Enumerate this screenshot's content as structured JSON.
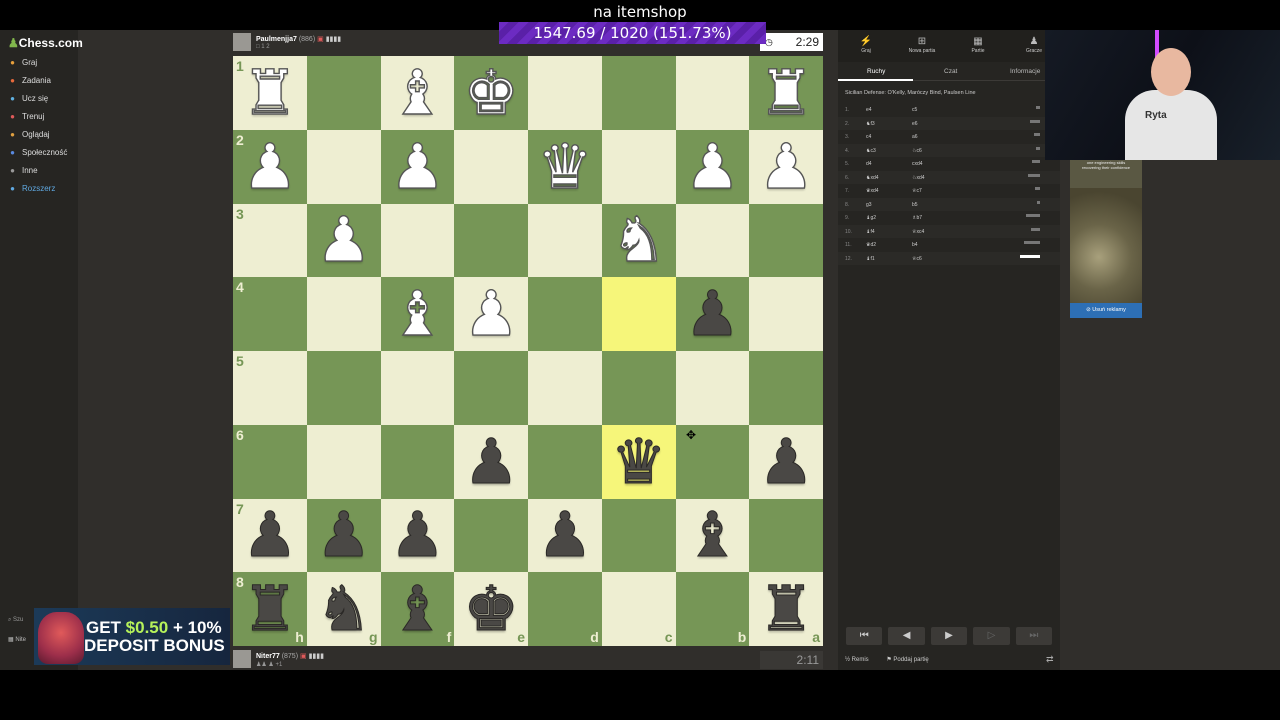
{
  "overlay": {
    "title": "na itemshop",
    "progress_text": "1547.69 / 1020 (151.73%)",
    "progress_fraction": 1.5173
  },
  "sidebar": {
    "logo": "Chess.com",
    "items": [
      {
        "label": "Graj",
        "icon": "play-icon",
        "color": "#e8a03c"
      },
      {
        "label": "Zadania",
        "icon": "puzzle-icon",
        "color": "#e86a3c"
      },
      {
        "label": "Ucz się",
        "icon": "learn-icon",
        "color": "#5fb0e0"
      },
      {
        "label": "Trenuj",
        "icon": "train-icon",
        "color": "#e05a5a"
      },
      {
        "label": "Oglądaj",
        "icon": "watch-icon",
        "color": "#e0a040"
      },
      {
        "label": "Społeczność",
        "icon": "community-icon",
        "color": "#5a8ae0"
      },
      {
        "label": "Inne",
        "icon": "more-icon",
        "color": "#999999"
      },
      {
        "label": "Rozszerz",
        "icon": "diamond-icon",
        "color": "#5fa8e0"
      }
    ],
    "search_label": "Szu",
    "user_label": "Nite"
  },
  "players": {
    "top": {
      "name": "Paulmenjja7",
      "rating": "(886)",
      "meta": "□ 1 2",
      "clock": "2:29"
    },
    "bottom": {
      "name": "Niter77",
      "rating": "(875)",
      "meta": "♟♟ ♟ +1",
      "clock": "2:11"
    }
  },
  "board": {
    "ranks": [
      "1",
      "2",
      "3",
      "4",
      "5",
      "6",
      "7",
      "8"
    ],
    "files": [
      "h",
      "g",
      "f",
      "e",
      "d",
      "c",
      "b",
      "a"
    ],
    "rows": [
      [
        "wR",
        "",
        "wB",
        "wK",
        "",
        "",
        "",
        "wR"
      ],
      [
        "wP",
        "",
        "wP",
        "",
        "wQ",
        "",
        "wP",
        "wP"
      ],
      [
        "",
        "wP",
        "",
        "",
        "",
        "wN",
        "",
        ""
      ],
      [
        "",
        "",
        "wB",
        "wP",
        "",
        "",
        "bP",
        ""
      ],
      [
        "",
        "",
        "",
        "",
        "",
        "",
        "",
        ""
      ],
      [
        "",
        "",
        "",
        "bP",
        "",
        "bQ",
        "",
        "bP"
      ],
      [
        "bP",
        "bP",
        "bP",
        "",
        "bP",
        "",
        "bB",
        ""
      ],
      [
        "bR",
        "bN",
        "bB",
        "bK",
        "",
        "",
        "",
        "bR"
      ]
    ],
    "highlight": [
      [
        3,
        5
      ],
      [
        5,
        5
      ]
    ],
    "light_color": "#eeeed2",
    "dark_color": "#769656",
    "highlight_color": "#f6f67a"
  },
  "panel": {
    "top_tabs": [
      {
        "label": "Graj",
        "icon": "bolt-icon"
      },
      {
        "label": "Nowa partia",
        "icon": "new-game-icon"
      },
      {
        "label": "Partie",
        "icon": "games-icon"
      },
      {
        "label": "Gracze",
        "icon": "players-icon"
      }
    ],
    "sub_tabs": [
      "Ruchy",
      "Czat",
      "Informacje"
    ],
    "opening": "Sicilian Defense: O'Kelly, Maróczy Bind, Paulsen Line",
    "moves": [
      {
        "n": "1.",
        "w": "e4",
        "b": "c5"
      },
      {
        "n": "2.",
        "w": "♞f3",
        "b": "e6"
      },
      {
        "n": "3.",
        "w": "c4",
        "b": "a6"
      },
      {
        "n": "4.",
        "w": "♞c3",
        "b": "♘c6"
      },
      {
        "n": "5.",
        "w": "d4",
        "b": "cxd4"
      },
      {
        "n": "6.",
        "w": "♞xd4",
        "b": "♘xd4"
      },
      {
        "n": "7.",
        "w": "♛xd4",
        "b": "♕c7"
      },
      {
        "n": "8.",
        "w": "g3",
        "b": "b5"
      },
      {
        "n": "9.",
        "w": "♝g2",
        "b": "♗b7"
      },
      {
        "n": "10.",
        "w": "♝f4",
        "b": "♕xc4"
      },
      {
        "n": "11.",
        "w": "♛d2",
        "b": "b4"
      },
      {
        "n": "12.",
        "w": "♝f1",
        "b": "♕c6"
      }
    ],
    "nav_buttons": [
      "⏮",
      "◀",
      "▶",
      "▷",
      "⏭"
    ],
    "draw_label": "Remis",
    "resign_label": "Poddaj partię"
  },
  "ad": {
    "text": "one engineering skills recovering their confidence",
    "button": "Usuń reklamy"
  },
  "bonus": {
    "line1_prefix": "GET ",
    "line1_amount": "$0.50",
    "line1_suffix": " + 10%",
    "line2": "DEPOSIT BONUS"
  },
  "webcam": {
    "shirt_text": "Ryta"
  }
}
